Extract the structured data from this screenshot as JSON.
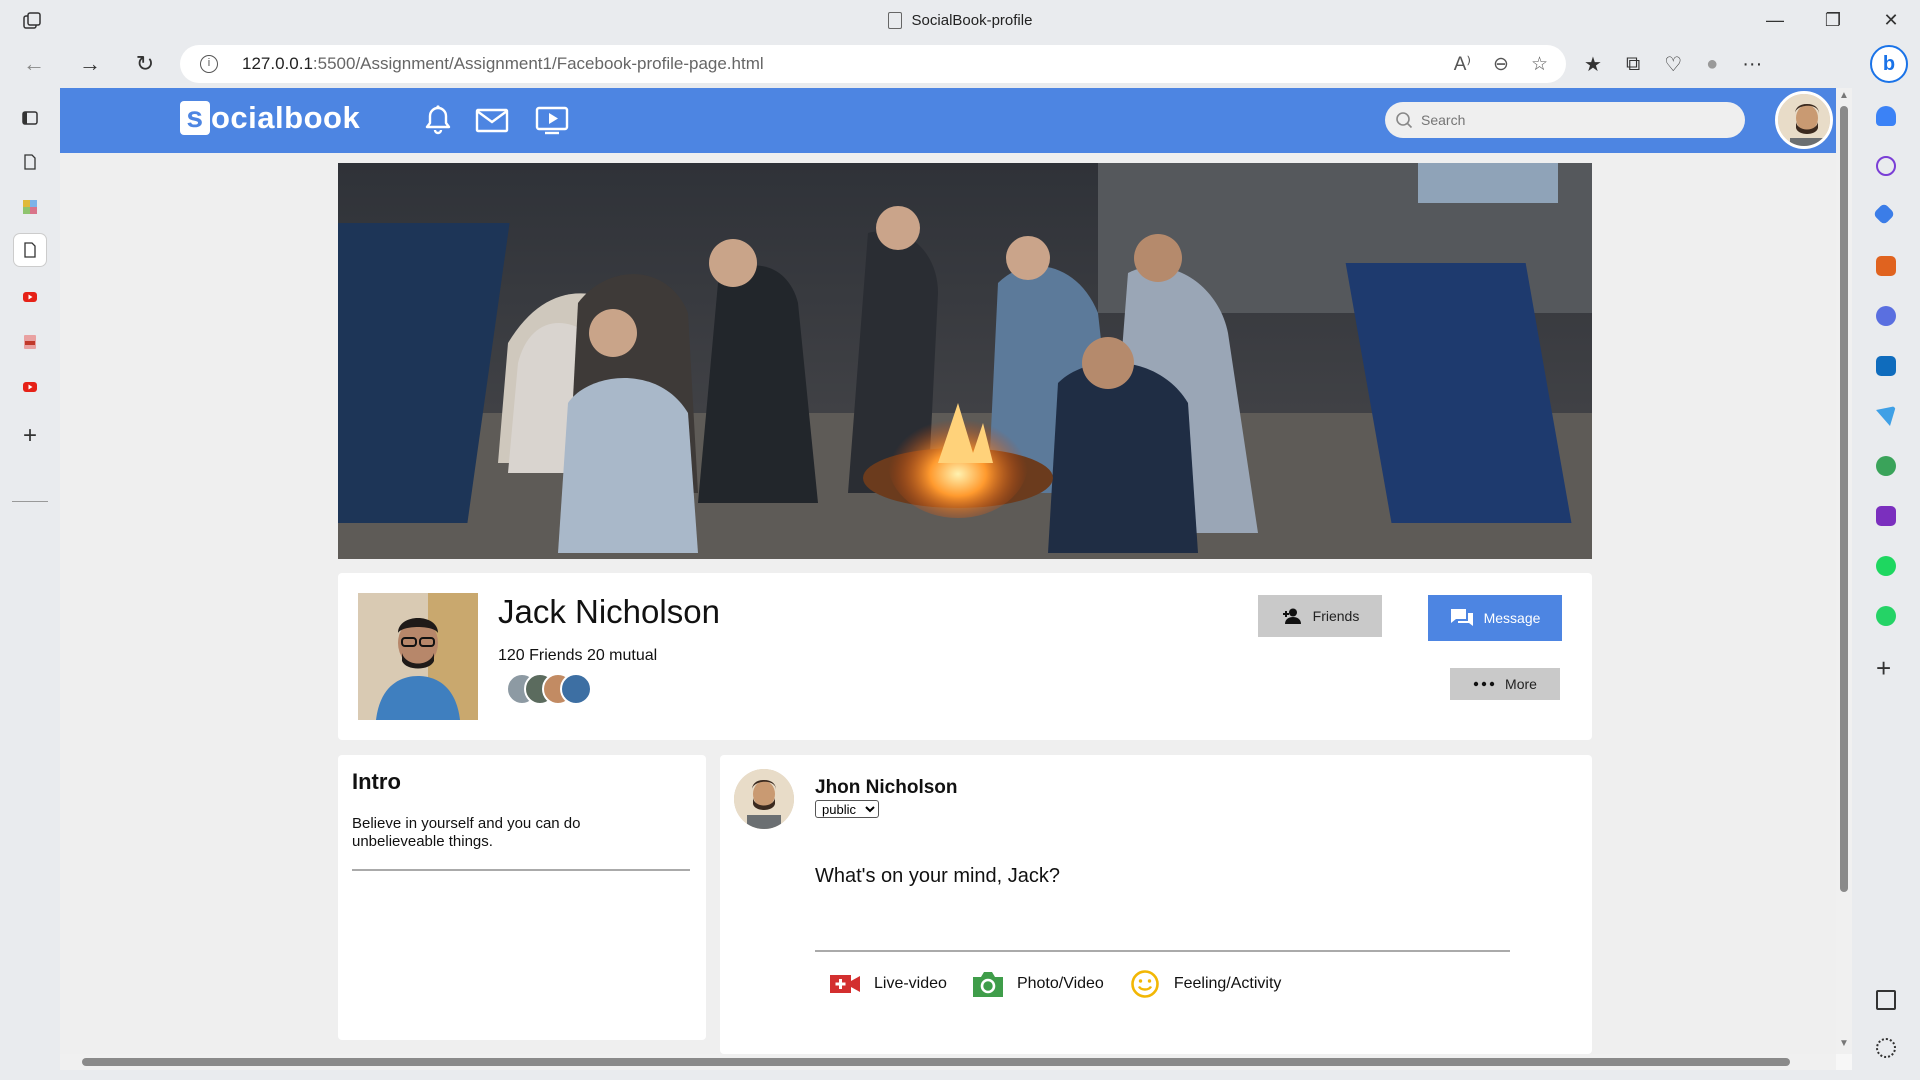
{
  "browser": {
    "tab_title": "SocialBook-profile",
    "url_host": "127.0.0.1",
    "url_rest": ":5500/Assignment/Assignment1/Facebook-profile-page.html",
    "info_glyph": "i",
    "bing_glyph": "b",
    "minimize_glyph": "—",
    "maximize_glyph": "❐",
    "close_glyph": "✕",
    "back_glyph": "←",
    "forward_glyph": "→",
    "refresh_glyph": "↻",
    "read_aloud_glyph": "A⁾",
    "zoom_out_glyph": "⊖",
    "favorite_glyph": "☆",
    "favorites_glyph": "★",
    "collections_glyph": "⧉",
    "heart_glyph": "♡",
    "profile_glyph": "●",
    "menu_glyph": "···",
    "plus_glyph": "+",
    "scroll_up_glyph": "▲",
    "scroll_down_glyph": "▼"
  },
  "site": {
    "logo_s": "s",
    "logo_rest": "ocialbook",
    "search_placeholder": "Search",
    "brand_color": "#4d85e2"
  },
  "profile": {
    "name": "Jack Nicholson",
    "friends_text": "120 Friends 20 mutual",
    "friends_button": "Friends",
    "message_button": "Message",
    "more_button": "More"
  },
  "intro": {
    "title": "Intro",
    "text": "Believe in yourself and you can do unbelieveable things."
  },
  "post": {
    "user": "Jhon Nicholson",
    "privacy_selected": "public",
    "prompt": "What's on your mind, Jack?",
    "actions": {
      "live": "Live-video",
      "photo": "Photo/Video",
      "feeling": "Feeling/Activity"
    }
  }
}
